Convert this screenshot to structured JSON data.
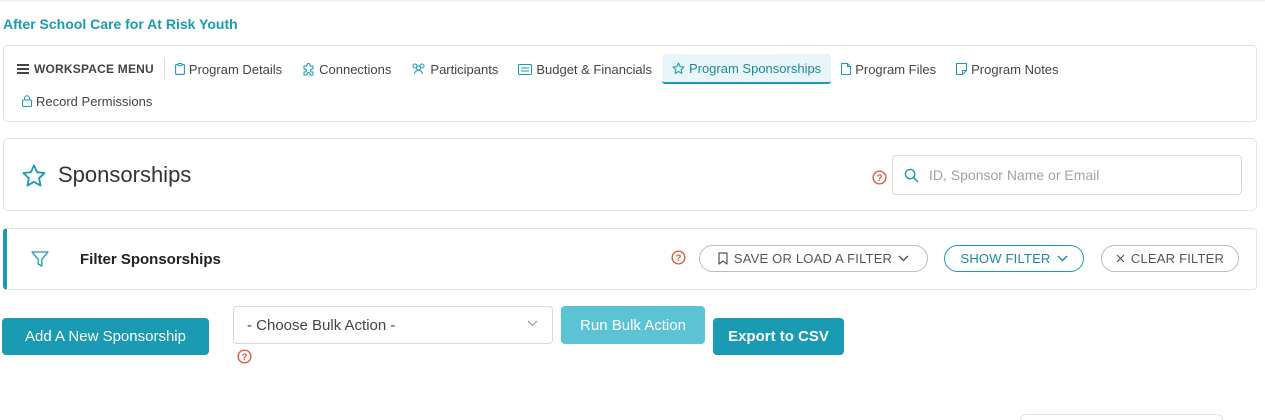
{
  "breadcrumb": "After School Care for At Risk Youth",
  "workspace": {
    "menu_title": "WORKSPACE MENU",
    "items": [
      {
        "label": "Program Details",
        "icon": "clipboard-icon"
      },
      {
        "label": "Connections",
        "icon": "puzzle-icon"
      },
      {
        "label": "Participants",
        "icon": "people-icon"
      },
      {
        "label": "Budget & Financials",
        "icon": "ledger-icon"
      },
      {
        "label": "Program Sponsorships",
        "icon": "star-icon",
        "active": true
      },
      {
        "label": "Program Files",
        "icon": "file-icon"
      },
      {
        "label": "Program Notes",
        "icon": "note-icon"
      },
      {
        "label": "Record Permissions",
        "icon": "lock-icon"
      }
    ]
  },
  "page": {
    "title": "Sponsorships",
    "search_placeholder": "ID, Sponsor Name or Email"
  },
  "filter": {
    "title": "Filter Sponsorships",
    "save_load_label": "SAVE OR LOAD A FILTER",
    "show_label": "SHOW FILTER",
    "clear_label": "CLEAR FILTER"
  },
  "actions": {
    "add_label": "Add A New Sponsorship",
    "bulk_select_value": "- Choose Bulk Action -",
    "run_bulk_label": "Run Bulk Action",
    "export_label": "Export to CSV"
  },
  "colors": {
    "accent": "#1b9bb3",
    "accent_light": "#5bc3d4",
    "help_red": "#e0552f"
  }
}
